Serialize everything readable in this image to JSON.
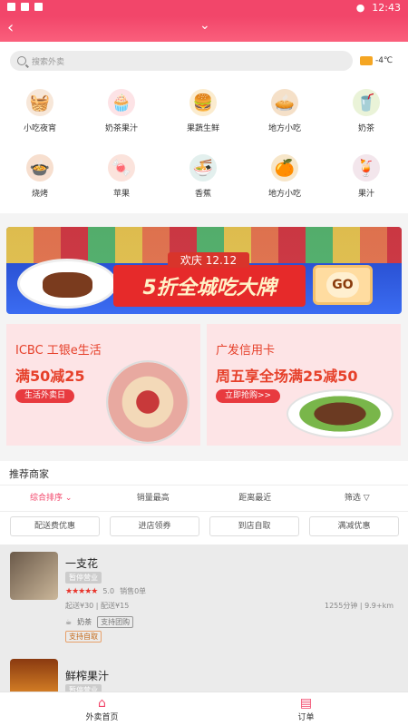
{
  "status": {
    "time": "12:43"
  },
  "search": {
    "placeholder": "搜索外卖",
    "weather": "-4℃"
  },
  "categories": [
    {
      "label": "小吃夜宵",
      "icon": "basket-icon"
    },
    {
      "label": "奶茶果汁",
      "icon": "cupcake-icon"
    },
    {
      "label": "果蔬生鲜",
      "icon": "burger-icon"
    },
    {
      "label": "地方小吃",
      "icon": "pie-icon"
    },
    {
      "label": "奶茶",
      "icon": "drink-icon"
    },
    {
      "label": "烧烤",
      "icon": "hotpot-icon"
    },
    {
      "label": "苹果",
      "icon": "candy-icon"
    },
    {
      "label": "香蕉",
      "icon": "noodle-icon"
    },
    {
      "label": "地方小吃",
      "icon": "fruit-basket-icon"
    },
    {
      "label": "果汁",
      "icon": "juice-icon"
    }
  ],
  "banner": {
    "subtitle": "欢庆 12.12",
    "title": "5折全城吃大牌",
    "go": "GO"
  },
  "promos": [
    {
      "title": "ICBC 工银e生活",
      "offer": "满50减25",
      "button": "生活外卖日"
    },
    {
      "title": "广发信用卡",
      "offer": "周五享全场满25减50",
      "button": "立即抢购>>"
    }
  ],
  "merchants": {
    "title": "推荐商家",
    "sort": [
      "综合排序",
      "销量最高",
      "距离最近",
      "筛选"
    ],
    "filters": [
      "配送费优惠",
      "进店领券",
      "到店自取",
      "满减优惠"
    ],
    "stores": [
      {
        "name": "一支花",
        "tag": "暂停营业",
        "rating": "5.0",
        "sales": "销售0单",
        "min": "起送¥30 | 配送¥15",
        "distance": "1255分钟 | 9.9+km",
        "category": "奶茶",
        "support": "支持团购",
        "pickup": "支持自取"
      },
      {
        "name": "鲜榨果汁",
        "tag": "暂停营业"
      }
    ]
  },
  "tabs": [
    {
      "label": "外卖首页"
    },
    {
      "label": "订单"
    }
  ],
  "colors": {
    "accent": "#f2466a",
    "promo_bg": "#fde4e6",
    "promo_text": "#e6402a"
  }
}
